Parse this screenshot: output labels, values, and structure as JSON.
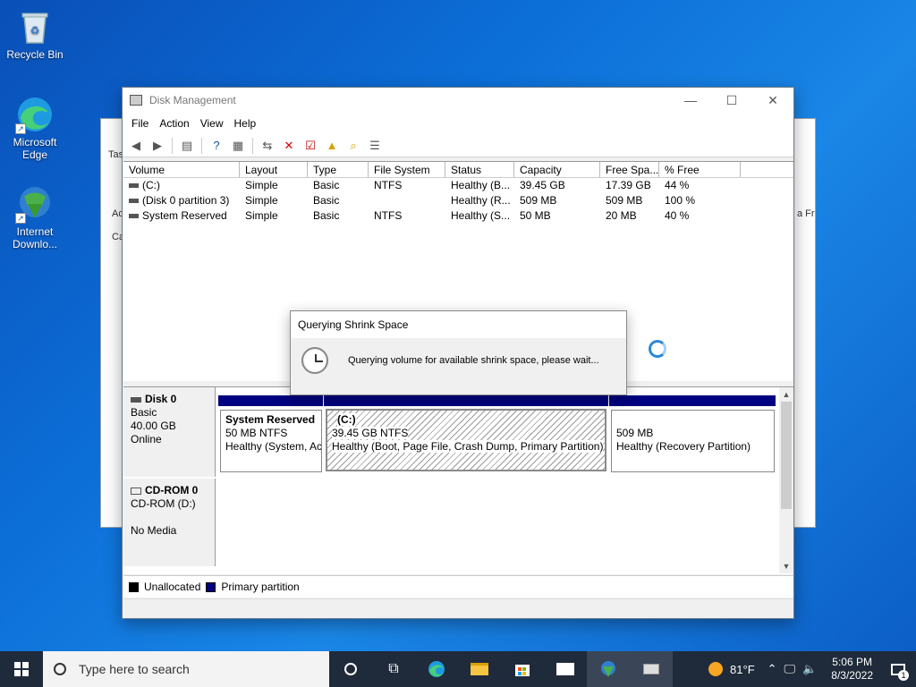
{
  "desktop": {
    "icons": [
      {
        "label": "Recycle Bin"
      },
      {
        "label": "Microsoft Edge"
      },
      {
        "label": "Internet Downlo..."
      }
    ],
    "bg_fragments": [
      "Tas",
      "Ac",
      "Ca",
      "a Fr"
    ]
  },
  "window": {
    "title": "Disk Management",
    "menu": [
      "File",
      "Action",
      "View",
      "Help"
    ],
    "columns": [
      "Volume",
      "Layout",
      "Type",
      "File System",
      "Status",
      "Capacity",
      "Free Spa...",
      "% Free"
    ],
    "volumes": [
      [
        "(C:)",
        "Simple",
        "Basic",
        "NTFS",
        "Healthy (B...",
        "39.45 GB",
        "17.39 GB",
        "44 %"
      ],
      [
        "(Disk 0 partition 3)",
        "Simple",
        "Basic",
        "",
        "Healthy (R...",
        "509 MB",
        "509 MB",
        "100 %"
      ],
      [
        "System Reserved",
        "Simple",
        "Basic",
        "NTFS",
        "Healthy (S...",
        "50 MB",
        "20 MB",
        "40 %"
      ]
    ],
    "disk0": {
      "name": "Disk 0",
      "type": "Basic",
      "size": "40.00 GB",
      "state": "Online",
      "partitions": [
        {
          "title": "System Reserved",
          "line1": "50 MB NTFS",
          "line2": "Healthy (System, Ac"
        },
        {
          "title": "(C:)",
          "line1": "39.45 GB NTFS",
          "line2": "Healthy (Boot, Page File, Crash Dump, Primary Partition)"
        },
        {
          "title": "",
          "line1": "509 MB",
          "line2": "Healthy (Recovery Partition)"
        }
      ]
    },
    "cdrom": {
      "name": "CD-ROM 0",
      "drive": "CD-ROM (D:)",
      "media": "No Media"
    },
    "legend": [
      {
        "label": "Unallocated",
        "color": "#000000"
      },
      {
        "label": "Primary partition",
        "color": "#000080"
      }
    ]
  },
  "dialog": {
    "title": "Querying Shrink Space",
    "message": "Querying volume for available shrink space, please wait..."
  },
  "taskbar": {
    "search_placeholder": "Type here to search",
    "weather": "81°F",
    "time": "5:06 PM",
    "date": "8/3/2022",
    "notification_count": "1"
  }
}
